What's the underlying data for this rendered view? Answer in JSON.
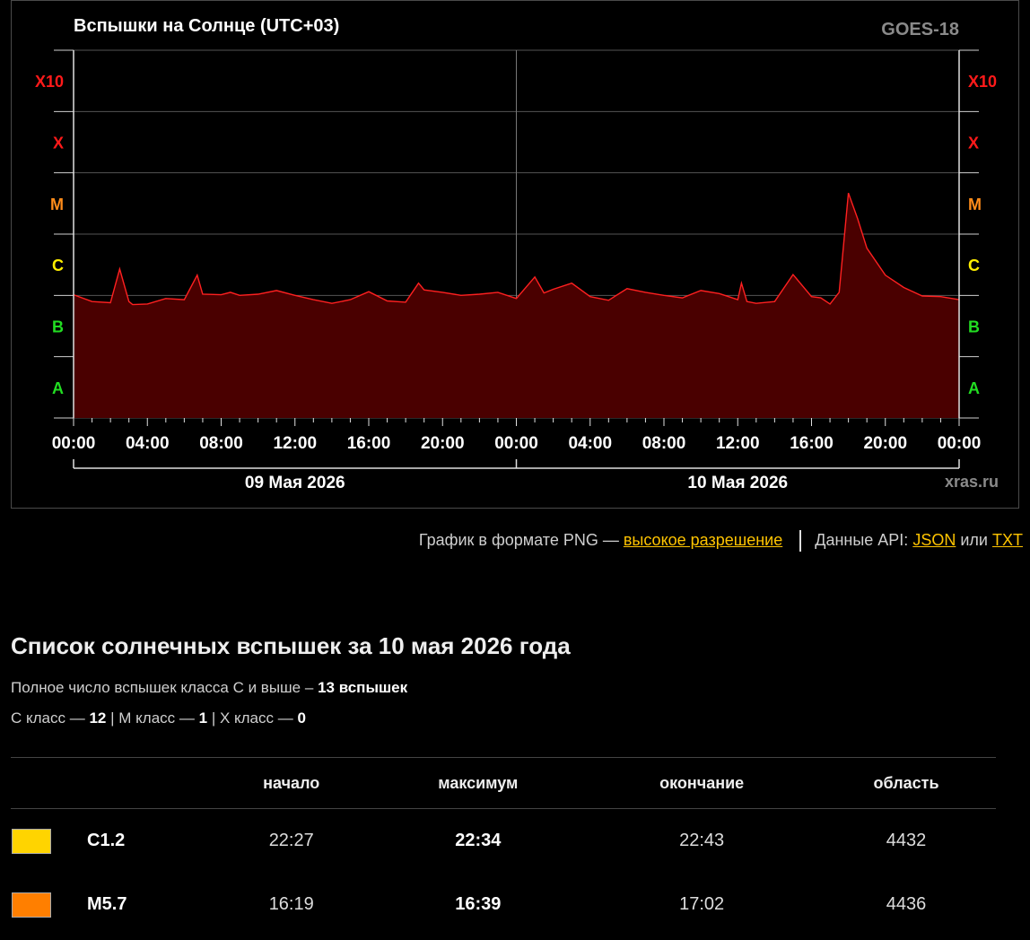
{
  "chart_data": {
    "type": "area",
    "title": "Вспышки на Солнце (UTC+03)",
    "satellite": "GOES-18",
    "watermark": "xras.ru",
    "x_ticks": [
      "00:00",
      "04:00",
      "08:00",
      "12:00",
      "16:00",
      "20:00",
      "00:00",
      "04:00",
      "08:00",
      "12:00",
      "16:00",
      "20:00",
      "00:00"
    ],
    "dates": [
      "09 Мая 2026",
      "10 Мая 2026"
    ],
    "y_scale": "log",
    "y_classes": [
      {
        "label": "A",
        "color": "#22dd22"
      },
      {
        "label": "B",
        "color": "#22dd22"
      },
      {
        "label": "C",
        "color": "#ffee00"
      },
      {
        "label": "M",
        "color": "#ff8c1a"
      },
      {
        "label": "X",
        "color": "#ff1a1a"
      },
      {
        "label": "X10",
        "color": "#ff1a1a"
      }
    ],
    "ylim_class_units": [
      0,
      6
    ],
    "grid": true,
    "series": [
      {
        "color": "#ff2020",
        "fill": "#4a0000",
        "x_hours": [
          0,
          1,
          2,
          2.5,
          3,
          3.2,
          4,
          5,
          6,
          6.7,
          7,
          8,
          8.5,
          9,
          10,
          11,
          12,
          13,
          14,
          15,
          16,
          17,
          18,
          18.7,
          19,
          20,
          21,
          22,
          23,
          24,
          25,
          25.5,
          26,
          27,
          28,
          29,
          30,
          31,
          32,
          33,
          34,
          35,
          36,
          36.2,
          36.5,
          37,
          38,
          39,
          40,
          40.5,
          41,
          41.5,
          42,
          42.5,
          43,
          44,
          45,
          46,
          47,
          48
        ],
        "y_class_units": [
          2.01,
          1.9,
          1.88,
          2.43,
          1.9,
          1.85,
          1.86,
          1.95,
          1.93,
          2.33,
          2.02,
          2.01,
          2.05,
          2.0,
          2.02,
          2.08,
          2.0,
          1.93,
          1.87,
          1.93,
          2.06,
          1.91,
          1.89,
          2.2,
          2.09,
          2.05,
          2.0,
          2.02,
          2.05,
          1.95,
          2.3,
          2.04,
          2.1,
          2.2,
          1.98,
          1.92,
          2.11,
          2.05,
          2.0,
          1.96,
          2.08,
          2.03,
          1.93,
          2.2,
          1.9,
          1.87,
          1.9,
          2.34,
          1.98,
          1.96,
          1.86,
          2.05,
          3.67,
          3.25,
          2.77,
          2.33,
          2.13,
          1.99,
          1.98,
          1.93
        ]
      }
    ]
  },
  "links": {
    "png_text": "График в формате PNG —",
    "hires": "высокое разрешение",
    "api_text": "Данные API:",
    "json": "JSON",
    "or": "или",
    "txt": "TXT"
  },
  "list": {
    "heading": "Список солнечных вспышек за 10 мая 2026 года",
    "total_text": "Полное число вспышек класса C и выше –",
    "total_value": "13 вспышек",
    "c_text": "C класс —",
    "c_value": "12",
    "m_text": "| M класс —",
    "m_value": "1",
    "x_text": "| X класс —",
    "x_value": "0"
  },
  "table": {
    "headers": [
      "начало",
      "максимум",
      "окончание",
      "область"
    ],
    "rows": [
      {
        "color": "#ffd400",
        "class": "C1.2",
        "start": "22:27",
        "peak": "22:34",
        "end": "22:43",
        "region": "4432"
      },
      {
        "color": "#ff7f00",
        "class": "M5.7",
        "start": "16:19",
        "peak": "16:39",
        "end": "17:02",
        "region": "4436"
      }
    ]
  }
}
